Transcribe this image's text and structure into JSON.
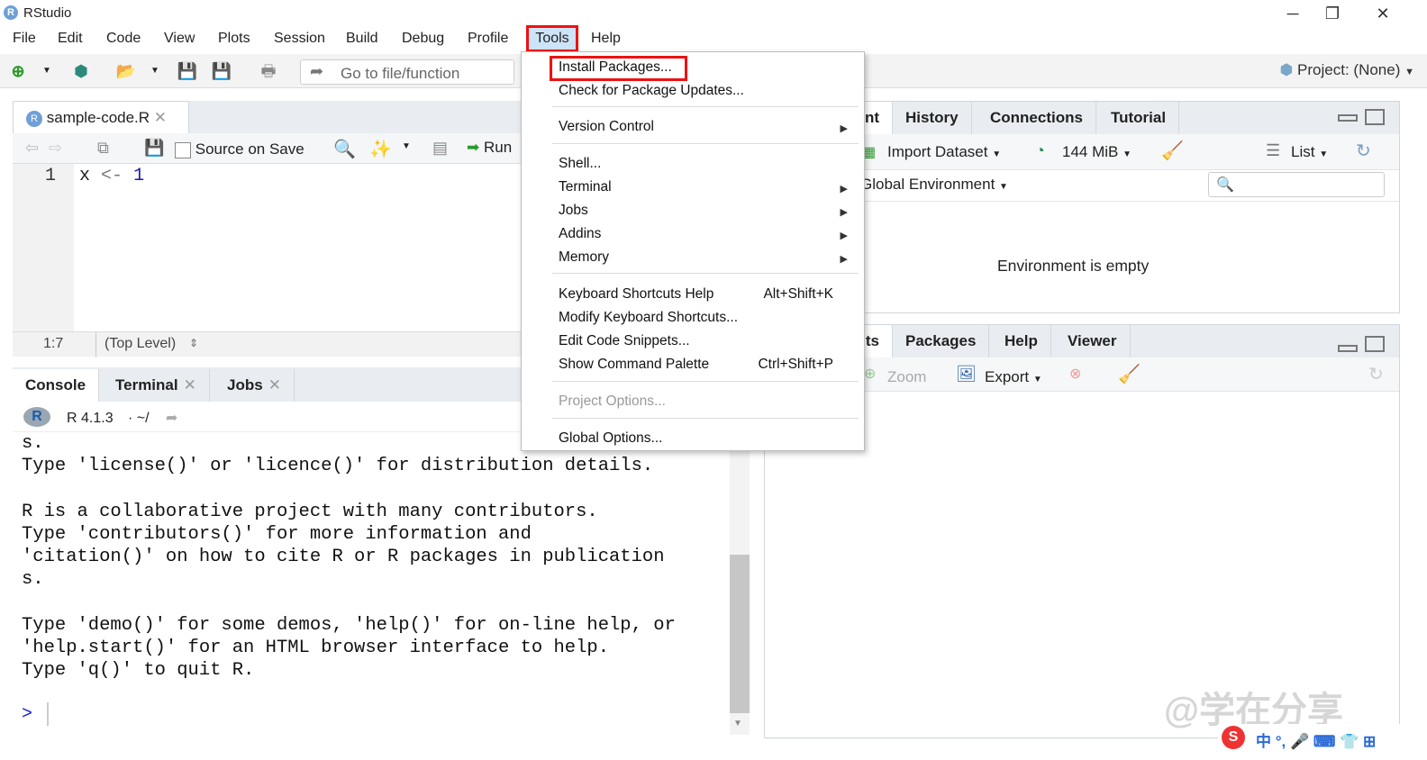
{
  "window": {
    "app_title": "RStudio",
    "controls": {
      "minimize": "─",
      "restore": "❐",
      "close": "✕"
    }
  },
  "menubar": {
    "items": [
      "File",
      "Edit",
      "Code",
      "View",
      "Plots",
      "Session",
      "Build",
      "Debug",
      "Profile",
      "Tools",
      "Help"
    ],
    "active": "Tools"
  },
  "toolbar": {
    "goto_placeholder": "Go to file/function",
    "project_label": "Project: (None)"
  },
  "editor": {
    "file_tab": "sample-code.R",
    "source_on_save": "Source on Save",
    "run_label": "Run",
    "line_number": "1",
    "code_line": {
      "var": "x",
      "op": "<-",
      "num": "1"
    },
    "cursor_pos": "1:7",
    "scope": "(Top Level)"
  },
  "console_pane": {
    "tabs": [
      {
        "label": "Console",
        "closable": false
      },
      {
        "label": "Terminal",
        "closable": true
      },
      {
        "label": "Jobs",
        "closable": true
      }
    ],
    "r_version": "R 4.1.3",
    "path": "· ~/",
    "output_lines": [
      "s.",
      "Type 'license()' or 'licence()' for distribution details.",
      "",
      "R is a collaborative project with many contributors.",
      "Type 'contributors()' for more information and",
      "'citation()' on how to cite R or R packages in publication",
      "s.",
      "",
      "Type 'demo()' for some demos, 'help()' for on-line help, or",
      "'help.start()' for an HTML browser interface to help.",
      "Type 'q()' to quit R."
    ],
    "prompt": ">"
  },
  "env_pane": {
    "tabs": [
      "nt",
      "History",
      "Connections",
      "Tutorial"
    ],
    "import_dataset": "Import Dataset",
    "memory": "144 MiB",
    "list_view": "List",
    "global_env": "Global Environment",
    "empty_message": "Environment is empty"
  },
  "files_pane": {
    "tabs": [
      "ts",
      "Packages",
      "Help",
      "Viewer"
    ],
    "zoom": "Zoom",
    "export": "Export"
  },
  "tools_menu": {
    "items": [
      {
        "label": "Install Packages...",
        "highlighted": true
      },
      {
        "label": "Check for Package Updates..."
      },
      {
        "label": "Version Control",
        "submenu": true
      },
      {
        "label": "Shell..."
      },
      {
        "label": "Terminal",
        "submenu": true
      },
      {
        "label": "Jobs",
        "submenu": true
      },
      {
        "label": "Addins",
        "submenu": true
      },
      {
        "label": "Memory",
        "submenu": true
      },
      {
        "label": "Keyboard Shortcuts Help",
        "shortcut": "Alt+Shift+K"
      },
      {
        "label": "Modify Keyboard Shortcuts..."
      },
      {
        "label": "Edit Code Snippets..."
      },
      {
        "label": "Show Command Palette",
        "shortcut": "Ctrl+Shift+P"
      },
      {
        "label": "Project Options...",
        "disabled": true
      },
      {
        "label": "Global Options..."
      }
    ]
  },
  "watermark": "@学在分享",
  "ime_bar": "中 °, 🎤 ⌨ 👕 ⊞",
  "colors": {
    "highlight_border": "#e11111",
    "tab_strip": "#e9edf1",
    "code_number": "#1a1aa6",
    "prompt": "#1a1ad6"
  }
}
